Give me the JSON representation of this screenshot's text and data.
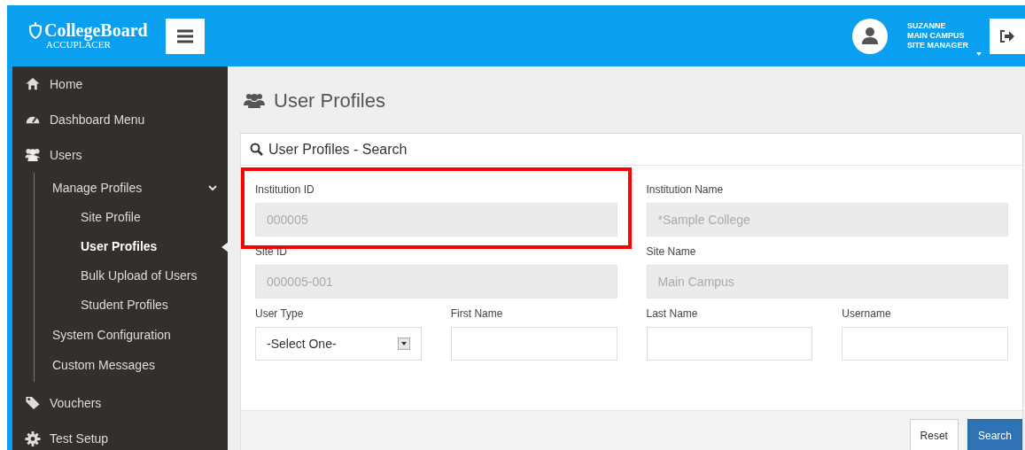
{
  "header": {
    "logo_title": "CollegeBoard",
    "logo_subtitle": "ACCUPLACER",
    "user_lines": [
      "SUZANNE",
      "MAIN CAMPUS",
      "SITE MANAGER"
    ]
  },
  "sidebar": {
    "items": [
      {
        "label": "Home",
        "selected": false
      },
      {
        "label": "Dashboard Menu",
        "selected": false
      },
      {
        "label": "Users",
        "selected": false,
        "children": [
          {
            "label": "Manage Profiles",
            "selected": false,
            "expanded": true,
            "children": [
              {
                "label": "Site Profile",
                "selected": false
              },
              {
                "label": "User Profiles",
                "selected": true
              },
              {
                "label": "Bulk Upload of Users",
                "selected": false
              },
              {
                "label": "Student Profiles",
                "selected": false
              }
            ]
          },
          {
            "label": "System Configuration",
            "selected": false
          },
          {
            "label": "Custom Messages",
            "selected": false
          }
        ]
      },
      {
        "label": "Vouchers",
        "selected": false
      },
      {
        "label": "Test Setup",
        "selected": false
      }
    ]
  },
  "page": {
    "title": "User Profiles"
  },
  "search_panel": {
    "title": "User Profiles - Search",
    "fields": [
      {
        "kind": "text",
        "label": "Institution ID",
        "value": "000005",
        "disabled": true,
        "highlighted": true
      },
      {
        "kind": "text",
        "label": "Institution Name",
        "value": "*Sample College",
        "disabled": true,
        "highlighted": false
      },
      {
        "kind": "text",
        "label": "Site ID",
        "value": "000005-001",
        "disabled": true,
        "highlighted": false
      },
      {
        "kind": "text",
        "label": "Site Name",
        "value": "Main Campus",
        "disabled": true,
        "highlighted": false
      },
      {
        "kind": "select",
        "label": "User Type",
        "value": "-Select One-",
        "disabled": false,
        "highlighted": false
      },
      {
        "kind": "text",
        "label": "First Name",
        "disabled": false,
        "highlighted": false
      },
      {
        "kind": "text",
        "label": "Last Name",
        "disabled": false,
        "highlighted": false
      },
      {
        "kind": "text",
        "label": "Username",
        "disabled": false,
        "highlighted": false
      }
    ],
    "buttons": [
      {
        "label": "Reset",
        "kind": "default"
      },
      {
        "label": "Search",
        "kind": "primary"
      }
    ]
  }
}
